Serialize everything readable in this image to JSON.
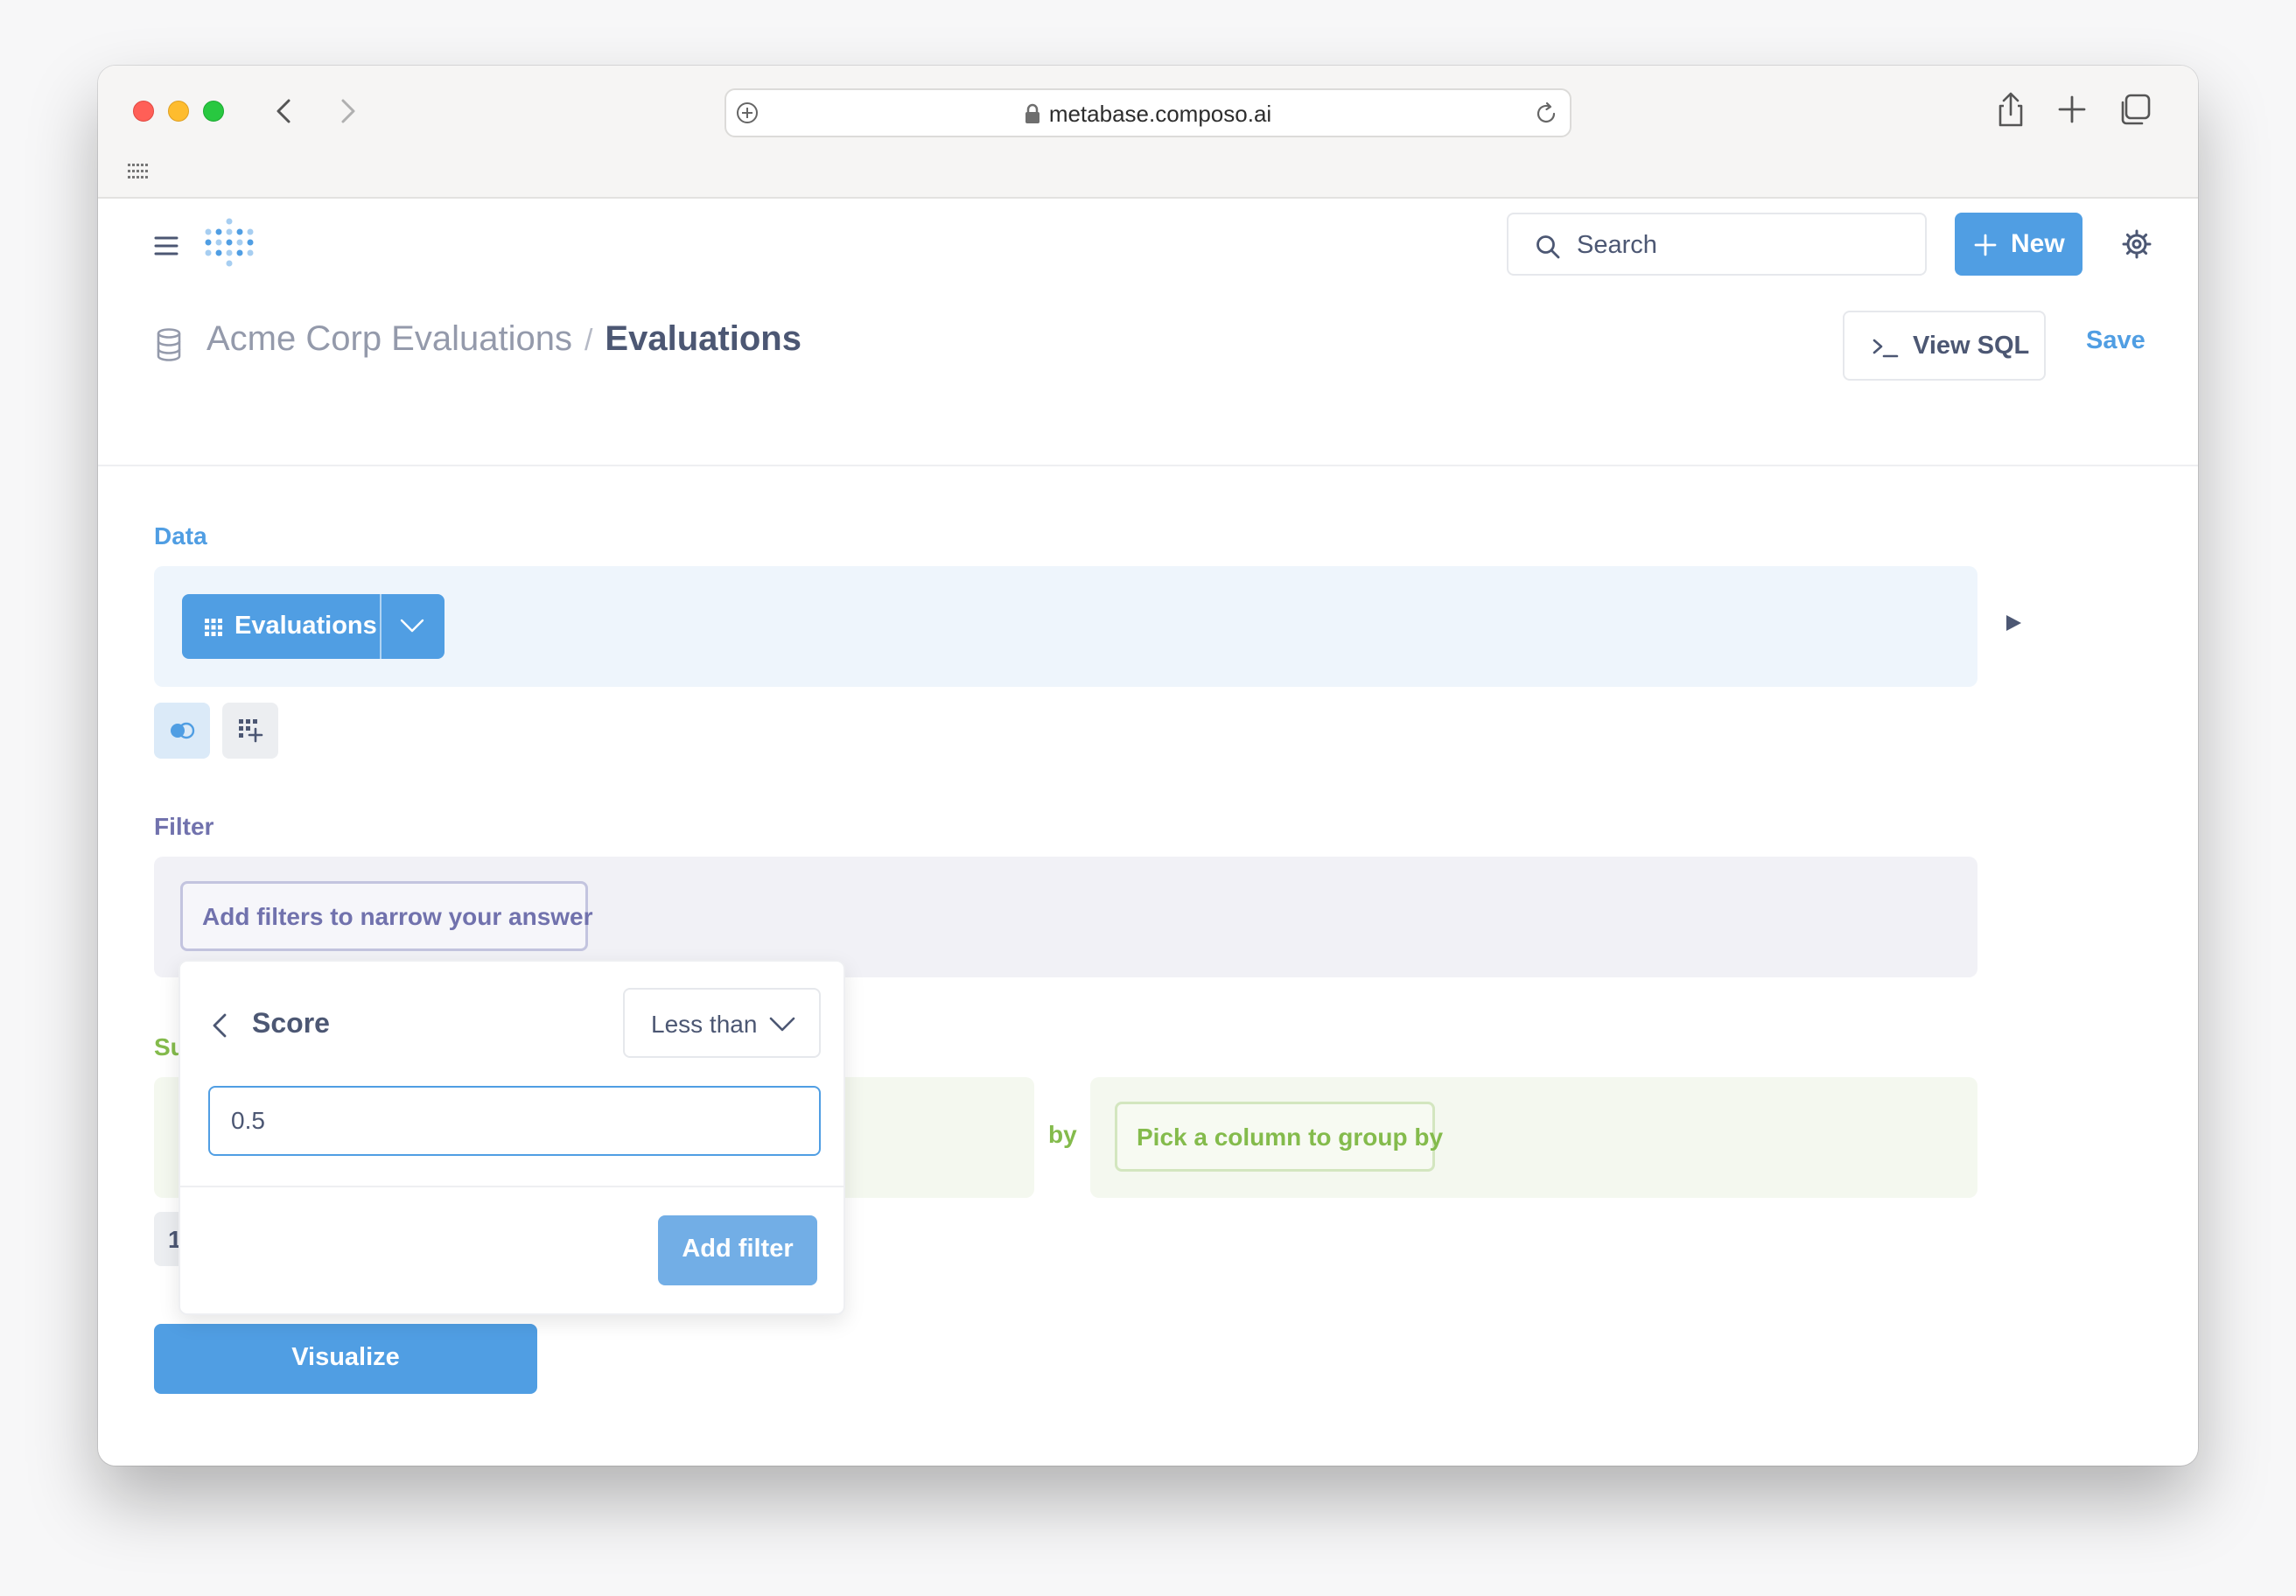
{
  "browser": {
    "url": "metabase.composo.ai"
  },
  "header": {
    "search_label": "Search",
    "new_label": "New"
  },
  "breadcrumb": {
    "database": "Acme Corp Evaluations",
    "separator": "/",
    "table": "Evaluations"
  },
  "actions": {
    "view_sql_label": "View SQL",
    "save_label": "Save"
  },
  "editor": {
    "data_label": "Data",
    "data_table": "Evaluations",
    "filter_label": "Filter",
    "filter_placeholder": "Add filters to narrow your answer",
    "summarize_label": "Su",
    "by_label": "by",
    "groupby_placeholder": "Pick a column to group by",
    "hidden_chip_text": "1",
    "visualize_label": "Visualize"
  },
  "filter_popover": {
    "column": "Score",
    "operator": "Less than",
    "value": "0.5",
    "add_label": "Add filter"
  },
  "colors": {
    "brand": "#509ee3",
    "filter": "#7172ad",
    "summarize": "#84bb4c",
    "text": "#4c5773"
  }
}
